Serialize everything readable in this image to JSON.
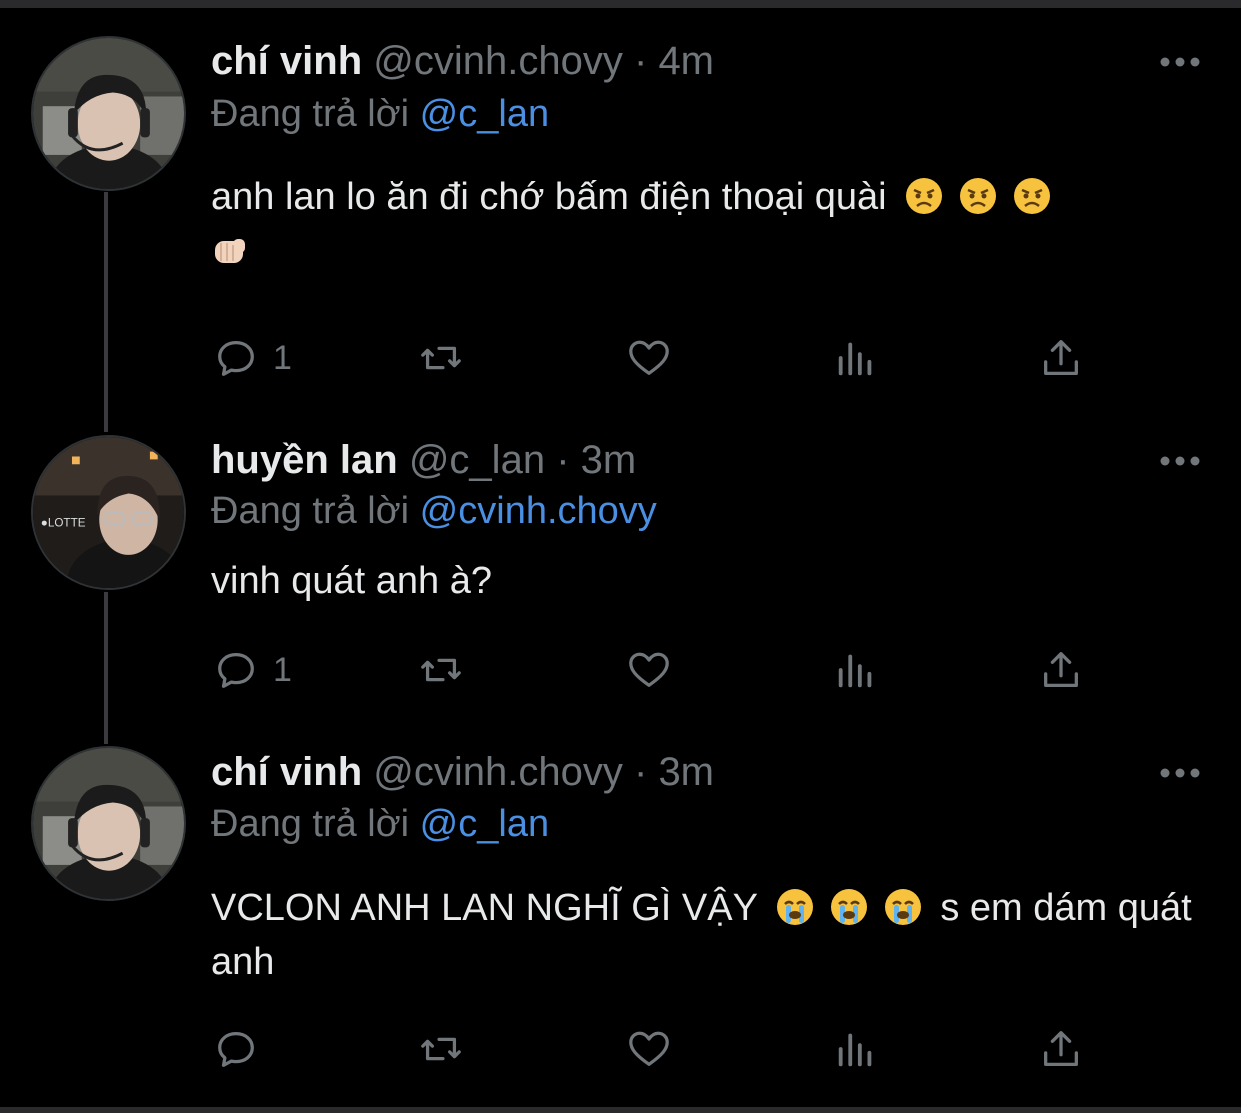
{
  "tweets": [
    {
      "name": "chí vinh",
      "handle": "@cvinh.chovy",
      "separator": "·",
      "time": "4m",
      "reply_prefix": "Đang trả lời",
      "reply_to": "@c_lan",
      "text": "anh lan lo ăn đi chớ bấm điện thoại quài",
      "emojis": [
        "angry-face",
        "angry-face",
        "angry-face",
        "fist-hand"
      ],
      "reply_count": "1"
    },
    {
      "name": "huyền lan",
      "handle": "@c_lan",
      "separator": "·",
      "time": "3m",
      "reply_prefix": "Đang trả lời",
      "reply_to": "@cvinh.chovy",
      "text": "vinh quát anh à?",
      "reply_count": "1"
    },
    {
      "name": "chí vinh",
      "handle": "@cvinh.chovy",
      "separator": "·",
      "time": "3m",
      "reply_prefix": "Đang trả lời",
      "reply_to": "@c_lan",
      "text_part1": "VCLON ANH LAN NGHĨ GÌ VẬY",
      "emojis": [
        "crying-face",
        "crying-face",
        "crying-face"
      ],
      "text_part2": "s em dám quát anh",
      "reply_count": ""
    }
  ],
  "colors": {
    "background": "#000000",
    "text": "#e7e9ea",
    "muted": "#71767b",
    "mention": "#4a8fe2",
    "thread_line": "#3a3b3e"
  },
  "icons": [
    "reply-icon",
    "retweet-icon",
    "like-icon",
    "views-icon",
    "share-icon",
    "more-icon"
  ]
}
